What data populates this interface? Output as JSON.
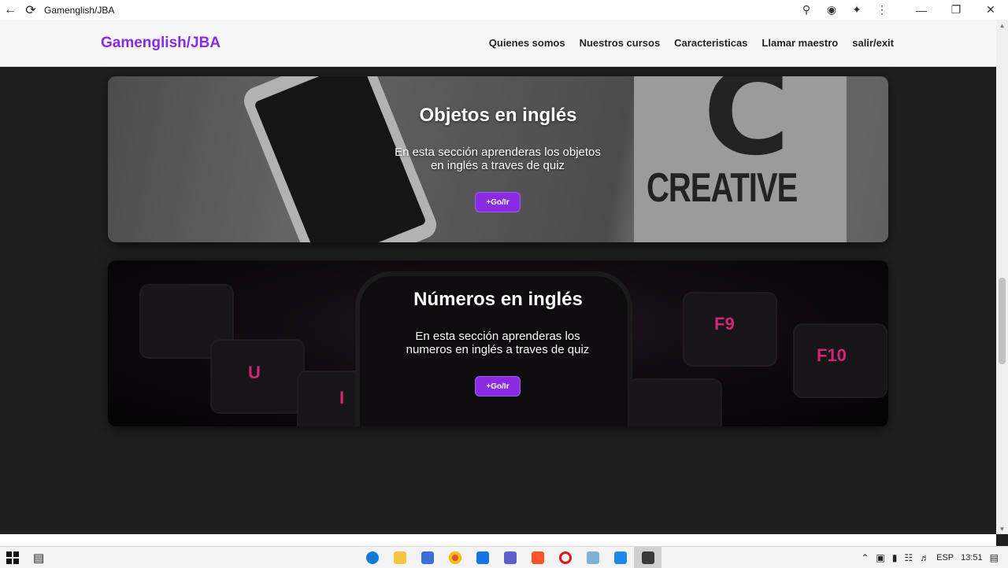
{
  "browser": {
    "title": "Gamenglish/JBA",
    "back_icon": "arrow-left-icon",
    "reload_icon": "reload-icon",
    "toolbar_icons": [
      "zoom-icon",
      "eye-off-icon",
      "extensions-icon",
      "menu-dots-icon"
    ],
    "window_controls": [
      "minimize-icon",
      "restore-icon",
      "close-icon"
    ]
  },
  "navbar": {
    "brand": "Gamenglish/JBA",
    "links": [
      "Quienes somos",
      "Nuestros cursos",
      "Caracteristicas",
      "Llamar maestro",
      "salir/exit"
    ],
    "brand_color": "#8a2be2"
  },
  "cards": [
    {
      "title": "Objetos en inglés",
      "description": "En esta sección aprenderas los objetos en inglés a traves de quiz",
      "button": "+Go/Ir",
      "image_text": [
        "C",
        "CREATIVE"
      ]
    },
    {
      "title": "Números en inglés",
      "description": "En esta sección aprenderas los numeros en inglés a traves de quiz",
      "button": "+Go/Ir",
      "image_text": [
        "F9",
        "F10",
        "U",
        "I"
      ]
    }
  ],
  "taskbar": {
    "apps": [
      "edge-icon",
      "file-explorer-icon",
      "store-icon",
      "chrome-icon",
      "mail-icon",
      "teams-icon",
      "brave-icon",
      "opera-icon",
      "notepad-icon",
      "photos-icon",
      "active-app-icon"
    ],
    "language": "ESP",
    "time": "13:51"
  },
  "colors": {
    "accent": "#8a2be2",
    "page_bg": "#1f1f1f"
  }
}
